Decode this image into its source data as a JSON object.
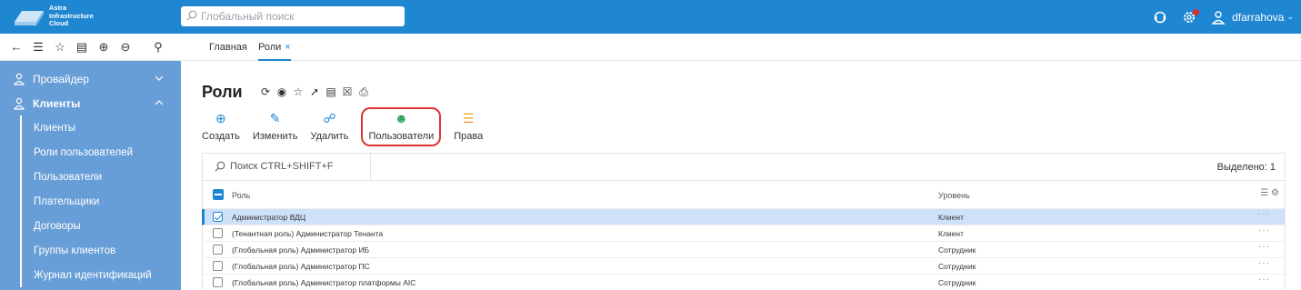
{
  "app": {
    "logo_text_line1": "Astra",
    "logo_text_line2": "Infrastructure",
    "logo_text_line3": "Cloud"
  },
  "header": {
    "search_placeholder": "Глобальный поиск",
    "username": "dfarrahova",
    "accent": "#1f86d1"
  },
  "tabs": [
    {
      "label": "Главная"
    },
    {
      "label": "Роли",
      "close": "×"
    }
  ],
  "sidebar": {
    "groups": [
      {
        "label": "Провайдер",
        "icon": "user-shield-icon"
      },
      {
        "label": "Клиенты",
        "icon": "user-shield-icon"
      }
    ],
    "items": [
      "Клиенты",
      "Роли пользователей",
      "Пользователи",
      "Плательщики",
      "Договоры",
      "Группы клиентов",
      "Журнал идентификаций"
    ]
  },
  "page": {
    "title": "Роли"
  },
  "actions": [
    {
      "label": "Создать",
      "icon": "plus-circle-icon"
    },
    {
      "label": "Изменить",
      "icon": "pencil-icon"
    },
    {
      "label": "Удалить",
      "icon": "delete-icon"
    },
    {
      "label": "Пользователи",
      "icon": "users-icon"
    },
    {
      "label": "Права",
      "icon": "rights-icon"
    }
  ],
  "grid": {
    "search_placeholder": "Поиск CTRL+SHIFT+F",
    "selected": "Выделено: 1",
    "columns": [
      "Роль",
      "Уровень"
    ],
    "rows": [
      {
        "role": "Администратор ВДЦ",
        "level": "Клиент",
        "selected": true
      },
      {
        "role": "(Тенантная роль) Администратор Тенанта",
        "level": "Клиент",
        "selected": false
      },
      {
        "role": "(Глобальная роль) Администратор ИБ",
        "level": "Сотрудник",
        "selected": false
      },
      {
        "role": "(Глобальная роль) Администратор ПС",
        "level": "Сотрудник",
        "selected": false
      },
      {
        "role": "(Глобальная роль) Администратор платформы AIC",
        "level": "Сотрудник",
        "selected": false
      }
    ],
    "row_menu": "···"
  }
}
